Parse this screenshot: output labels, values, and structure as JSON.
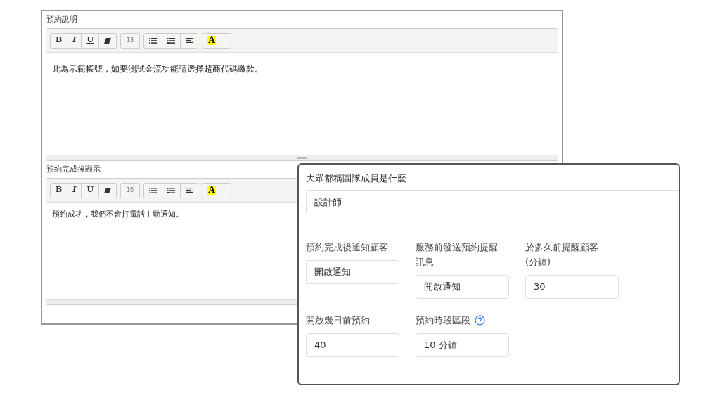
{
  "editors": [
    {
      "label": "預約說明",
      "toolbar": {
        "bold": "B",
        "italic": "I",
        "underline": "U",
        "font_size": "18",
        "highlight": "A"
      },
      "content": "此為示範帳號，如要測試金流功能請選擇超商代碼繳款。"
    },
    {
      "label": "預約完成後顯示",
      "toolbar": {
        "bold": "B",
        "italic": "I",
        "underline": "U",
        "font_size": "16",
        "highlight": "A"
      },
      "content": "預約成功，我們不會打電話主動通知。"
    }
  ],
  "settings_panel": {
    "team_name": {
      "label": "大眾都稱團隊成員是什麼",
      "value": "設計師"
    },
    "rows": [
      [
        {
          "label": "預約完成後通知顧客",
          "value": "開啟通知",
          "help": false
        },
        {
          "label": "服務前發送預約提醒訊息",
          "value": "開啟通知",
          "help": false
        },
        {
          "label": "於多久前提醒顧客(分鐘)",
          "value": "30",
          "help": false
        }
      ],
      [
        {
          "label": "開放幾日前預約",
          "value": "40",
          "help": false
        },
        {
          "label": "預約時段區段",
          "value": "10 分鐘",
          "help": true
        }
      ]
    ]
  }
}
